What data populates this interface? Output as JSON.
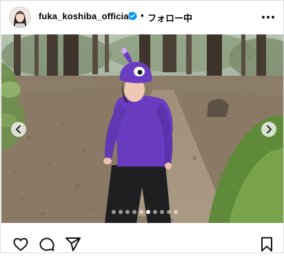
{
  "post": {
    "username": "fuka_koshiba_official",
    "verified": true,
    "separator": "•",
    "follow_status": "フォロー中",
    "more_icon": "more-horizontal-icon"
  },
  "carousel": {
    "total_slides": 10,
    "active_slide": 6,
    "prev_icon": "chevron-left-icon",
    "next_icon": "chevron-right-icon"
  },
  "actions": {
    "like_icon": "heart-icon",
    "comment_icon": "comment-icon",
    "share_icon": "paper-plane-icon",
    "save_icon": "bookmark-icon"
  },
  "colors": {
    "verified_blue": "#0095f6",
    "border": "#dbdbdb",
    "sweater_purple": "#6a3cc0"
  }
}
